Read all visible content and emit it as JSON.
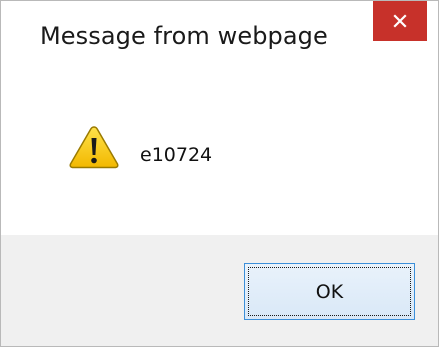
{
  "dialog": {
    "title": "Message from webpage",
    "message": "e10724",
    "ok_label": "OK",
    "close_glyph": "×"
  },
  "icons": {
    "close": "close-icon",
    "warning": "warning-icon"
  },
  "colors": {
    "close_button": "#c7312a",
    "footer_bg": "#f0f0f0",
    "ok_border": "#3c8fd9",
    "warning_fill": "#f5c400"
  }
}
